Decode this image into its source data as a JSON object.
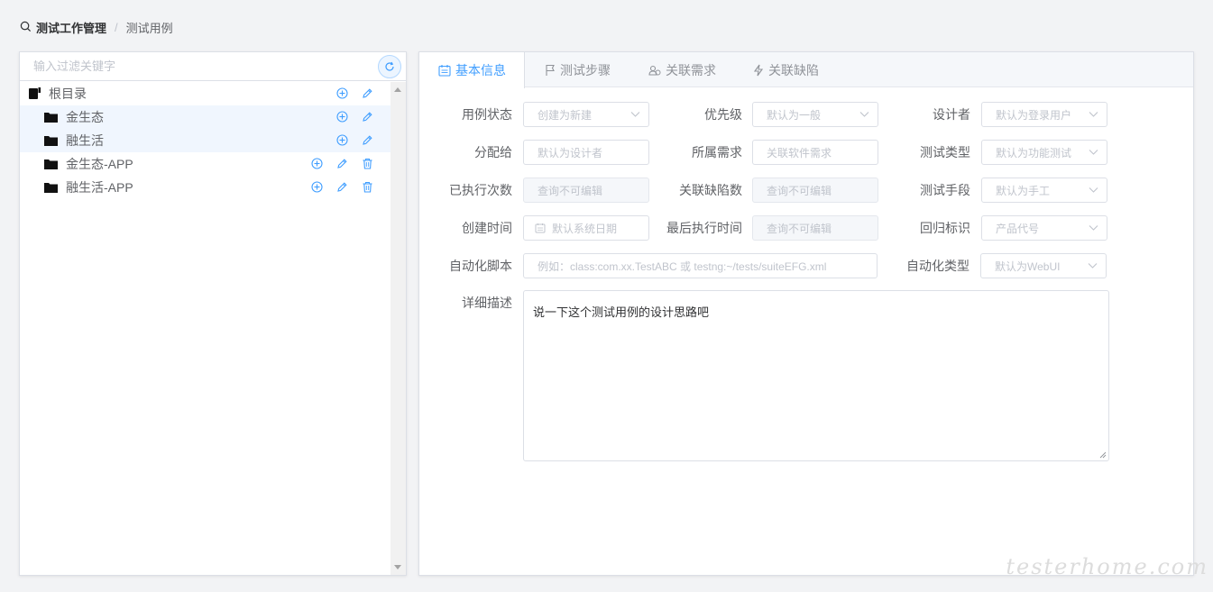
{
  "breadcrumb": {
    "main": "测试工作管理",
    "separator": "/",
    "current": "测试用例"
  },
  "filter": {
    "placeholder": "输入过滤关键字"
  },
  "tree": {
    "root": "根目录",
    "folders": [
      "金生态",
      "融生活",
      "金生态-APP",
      "融生活-APP"
    ]
  },
  "tabs": {
    "basic": "基本信息",
    "steps": "测试步骤",
    "requirements": "关联需求",
    "defects": "关联缺陷"
  },
  "form": {
    "case_status": {
      "label": "用例状态",
      "placeholder": "创建为新建"
    },
    "priority": {
      "label": "优先级",
      "placeholder": "默认为一般"
    },
    "designer": {
      "label": "设计者",
      "placeholder": "默认为登录用户"
    },
    "assignee": {
      "label": "分配给",
      "placeholder": "默认为设计者"
    },
    "requirement": {
      "label": "所属需求",
      "placeholder": "关联软件需求"
    },
    "test_type": {
      "label": "测试类型",
      "placeholder": "默认为功能测试"
    },
    "exec_count": {
      "label": "已执行次数",
      "placeholder": "查询不可编辑"
    },
    "defect_count": {
      "label": "关联缺陷数",
      "placeholder": "查询不可编辑"
    },
    "test_method": {
      "label": "测试手段",
      "placeholder": "默认为手工"
    },
    "created_time": {
      "label": "创建时间",
      "placeholder": "默认系统日期"
    },
    "last_exec_time": {
      "label": "最后执行时间",
      "placeholder": "查询不可编辑"
    },
    "regression": {
      "label": "回归标识",
      "placeholder": "产品代号"
    },
    "auto_script": {
      "label": "自动化脚本",
      "placeholder": "例如：class:com.xx.TestABC 或 testng:~/tests/suiteEFG.xml"
    },
    "auto_type": {
      "label": "自动化类型",
      "placeholder": "默认为WebUI"
    },
    "description": {
      "label": "详细描述",
      "value": "说一下这个测试用例的设计思路吧"
    }
  },
  "watermark": "testerhome.com",
  "colors": {
    "accent": "#409eff",
    "border": "#dcdfe6",
    "page_bg": "#f2f3f5"
  }
}
